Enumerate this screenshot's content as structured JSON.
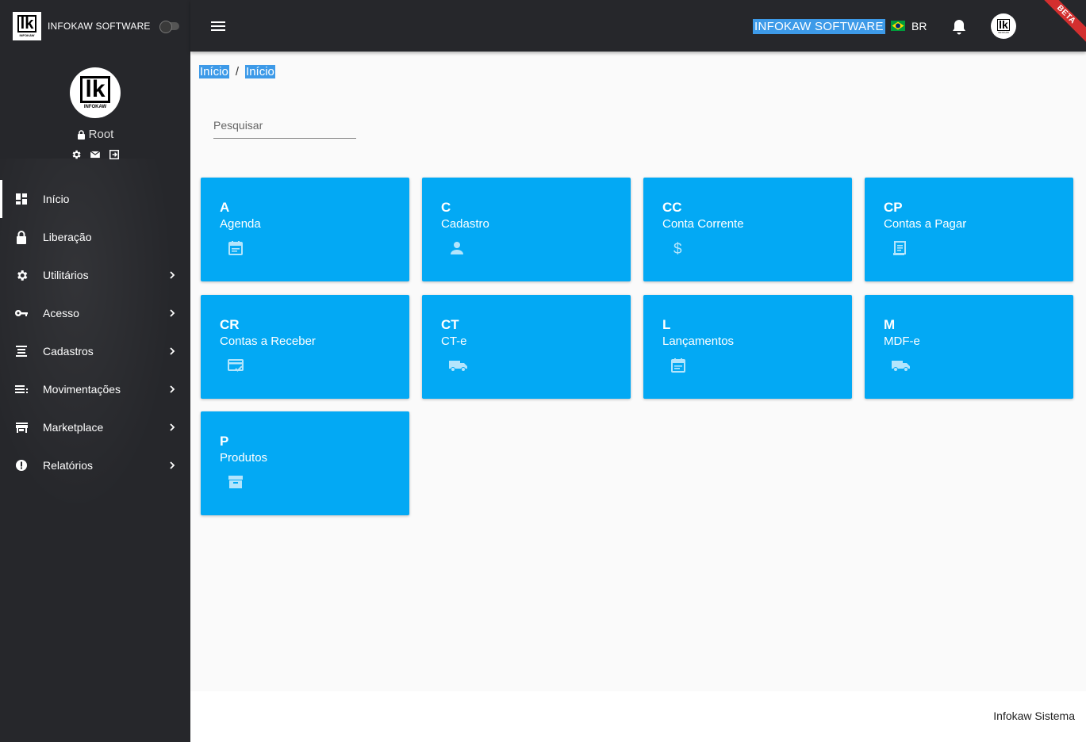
{
  "app": {
    "brand_name": "INFOKAW SOFTWARE",
    "logo_text": "lk",
    "logo_sub": "INFOKAW"
  },
  "profile": {
    "user": "Root"
  },
  "sidebar": {
    "items": [
      {
        "label": "Início",
        "icon": "dashboard-icon",
        "active": true
      },
      {
        "label": "Liberação",
        "icon": "lock-icon"
      },
      {
        "label": "Utilitários",
        "icon": "gear-icon"
      },
      {
        "label": "Acesso",
        "icon": "key-icon"
      },
      {
        "label": "Cadastros",
        "icon": "list-icon"
      },
      {
        "label": "Movimentações",
        "icon": "menu-lines-icon"
      },
      {
        "label": "Marketplace",
        "icon": "store-icon"
      },
      {
        "label": "Relatórios",
        "icon": "alert-icon"
      }
    ]
  },
  "topbar": {
    "company": "INFOKAW SOFTWARE",
    "language": "BR",
    "beta_label": "BETA"
  },
  "breadcrumb": {
    "first": "Início",
    "separator": "/",
    "second": "Início"
  },
  "search": {
    "placeholder": "Pesquisar"
  },
  "tiles": [
    {
      "abbr": "A",
      "name": "Agenda",
      "icon": "calendar-icon"
    },
    {
      "abbr": "C",
      "name": "Cadastro",
      "icon": "person-icon"
    },
    {
      "abbr": "CC",
      "name": "Conta Corrente",
      "icon": "dollar-icon"
    },
    {
      "abbr": "CP",
      "name": "Contas a Pagar",
      "icon": "receipt-icon"
    },
    {
      "abbr": "CR",
      "name": "Contas a Receber",
      "icon": "card-check-icon"
    },
    {
      "abbr": "CT",
      "name": "CT-e",
      "icon": "truck-icon"
    },
    {
      "abbr": "L",
      "name": "Lançamentos",
      "icon": "calendar-icon"
    },
    {
      "abbr": "M",
      "name": "MDF-e",
      "icon": "truck-icon"
    },
    {
      "abbr": "P",
      "name": "Produtos",
      "icon": "archive-icon"
    }
  ],
  "footer": {
    "text": "Infokaw Sistema"
  },
  "colors": {
    "sidebar_bg": "#26272b",
    "tile_bg": "#03a9f4",
    "highlight": "#3d9ae8",
    "beta_ribbon": "#d32f2f"
  }
}
